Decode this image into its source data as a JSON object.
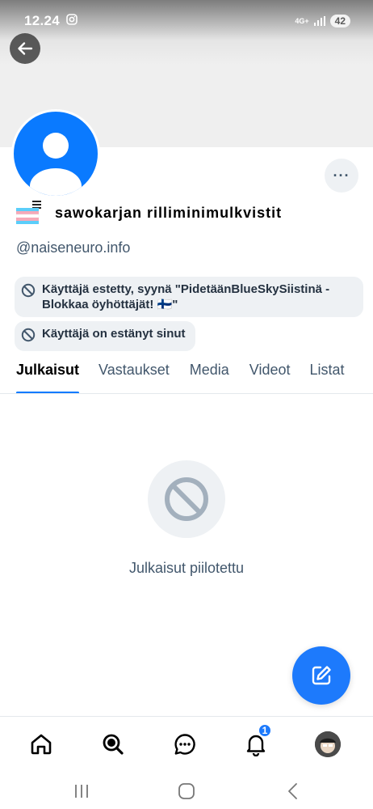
{
  "status_bar": {
    "time": "12.24",
    "network": "4G+",
    "battery": "42"
  },
  "profile": {
    "display_name": "sawokarjan rilliminimulkvistit",
    "handle": "@naiseneuro.info",
    "block_reason": "Käyttäjä estetty, syynä \"PidetäänBlueSkySiistinä - Blokkaa öyhöttäjät! 🇫🇮\"",
    "blocked_by": "Käyttäjä on estänyt sinut",
    "more_label": "···"
  },
  "tabs": [
    {
      "label": "Julkaisut",
      "active": true
    },
    {
      "label": "Vastaukset",
      "active": false
    },
    {
      "label": "Media",
      "active": false
    },
    {
      "label": "Videot",
      "active": false
    },
    {
      "label": "Listat",
      "active": false
    }
  ],
  "empty_state": {
    "text": "Julkaisut piilotettu",
    "icon": "ban-icon"
  },
  "bottom_nav": {
    "items": [
      "home-icon",
      "search-icon",
      "chat-icon",
      "bell-icon",
      "user-avatar"
    ],
    "notification_count": "1"
  },
  "colors": {
    "accent": "#1d7afc",
    "avatar_bg": "#0a7aff",
    "muted_text": "#42576c",
    "chip_bg": "#eef1f4"
  }
}
